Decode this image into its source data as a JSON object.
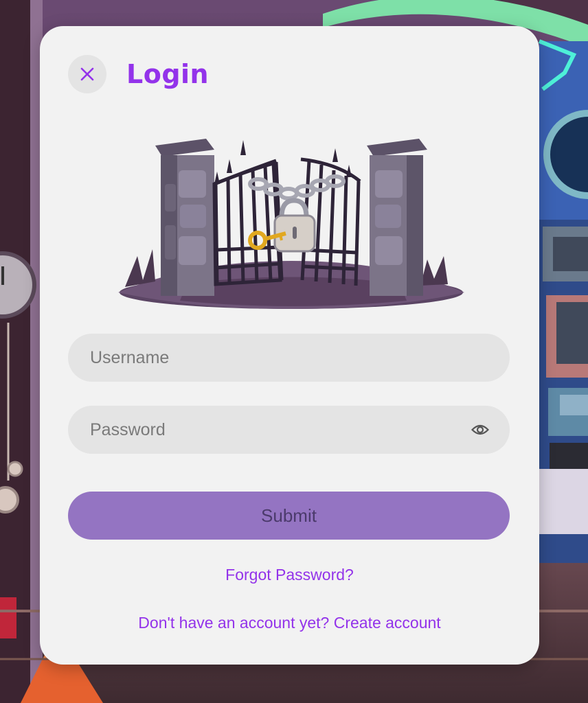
{
  "modal": {
    "title": "Login",
    "close_icon": "close-icon"
  },
  "illustration": {
    "icon": "locked-gate-illustration"
  },
  "form": {
    "username": {
      "placeholder": "Username",
      "value": ""
    },
    "password": {
      "placeholder": "Password",
      "value": "",
      "toggle_icon": "eye-icon"
    },
    "submit_label": "Submit"
  },
  "links": {
    "forgot_password": "Forgot Password?",
    "no_account_prefix": "Don't have an account yet?",
    "create_account": "Create account"
  },
  "colors": {
    "accent": "#9333ea",
    "submit_bg": "#9474c2",
    "field_bg": "#e4e4e4",
    "modal_bg": "#f2f2f2"
  }
}
